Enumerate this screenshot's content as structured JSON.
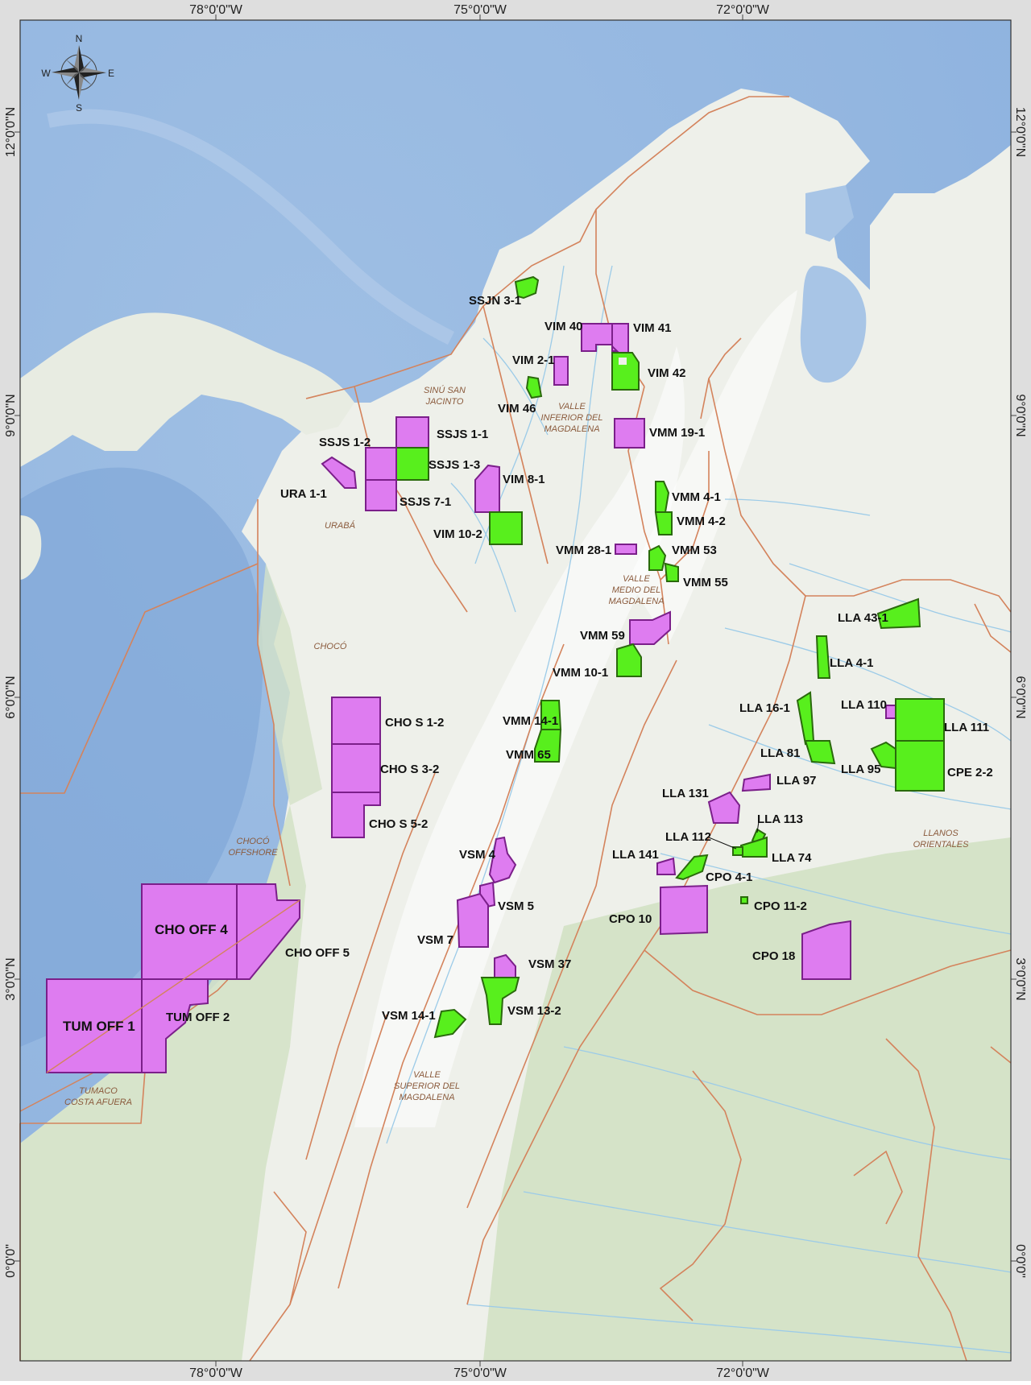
{
  "colors": {
    "ocean": "#a8c5e6",
    "ocean_deep": "#7ea8d9",
    "land": "#eef0ec",
    "land_green": "#d3e2c6",
    "border": "#d4835c",
    "river": "#9ccbe8",
    "block_magenta": "#de7cf0",
    "block_magenta_stroke": "#7b1f8a",
    "block_green": "#58ef1d",
    "block_green_stroke": "#2a6a0c",
    "frame": "#dcdcdc"
  },
  "coords": {
    "top": [
      "78°0'0\"W",
      "75°0'0\"W",
      "72°0'0\"W"
    ],
    "bottom": [
      "78°0'0\"W",
      "75°0'0\"W",
      "72°0'0\"W"
    ],
    "left": [
      "12°0'0\"N",
      "9°0'0\"N",
      "6°0'0\"N",
      "3°0'0\"N",
      "0°0'0\""
    ],
    "right": [
      "12°0'0\"N",
      "9°0'0\"N",
      "6°0'0\"N",
      "3°0'0\"N",
      "0°0'0\""
    ]
  },
  "compass": {
    "n": "N",
    "s": "S",
    "e": "E",
    "w": "W",
    "icon": "compass-rose-icon"
  },
  "regions": [
    "SINÚ SAN",
    "JACINTO",
    "VALLE",
    "INFERIOR DEL",
    "MAGDALENA",
    "URABÁ",
    "VALLE",
    "MEDIO DEL",
    "MAGDALENA",
    "CHOCÓ",
    "CHOCÓ",
    "OFFSHORE",
    "LLANOS",
    "ORIENTALES",
    "VALLE",
    "SUPERIOR DEL",
    "MAGDALENA",
    "TUMACO",
    "COSTA AFUERA"
  ],
  "blocks": [
    "SSJN 3-1",
    "VIM 40",
    "VIM 41",
    "VIM 2-1",
    "VIM 42",
    "VIM 46",
    "SSJS 1-2",
    "SSJS 1-1",
    "SSJS 1-3",
    "URA 1-1",
    "SSJS 7-1",
    "VIM 8-1",
    "VIM 10-2",
    "VMM 19-1",
    "VMM 4-1",
    "VMM 4-2",
    "VMM 28-1",
    "VMM 53",
    "VMM 55",
    "LLA 43-1",
    "VMM 59",
    "LLA 4-1",
    "VMM 10-1",
    "CHO S 1-2",
    "VMM 14-1",
    "LLA 16-1",
    "LLA 110",
    "LLA 111",
    "VMM 65",
    "CHO S 3-2",
    "LLA 81",
    "LLA 95",
    "CPE 2-2",
    "LLA 97",
    "LLA 131",
    "CHO S 5-2",
    "LLA 113",
    "LLA 112",
    "VSM 4",
    "LLA 141",
    "LLA 74",
    "CPO 4-1",
    "VSM 5",
    "CPO 11-2",
    "CHO OFF 4",
    "CPO 10",
    "VSM 7",
    "CHO OFF 5",
    "CPO 18",
    "VSM 37",
    "VSM 13-2",
    "VSM 14-1",
    "TUM OFF 1",
    "TUM OFF 2"
  ]
}
